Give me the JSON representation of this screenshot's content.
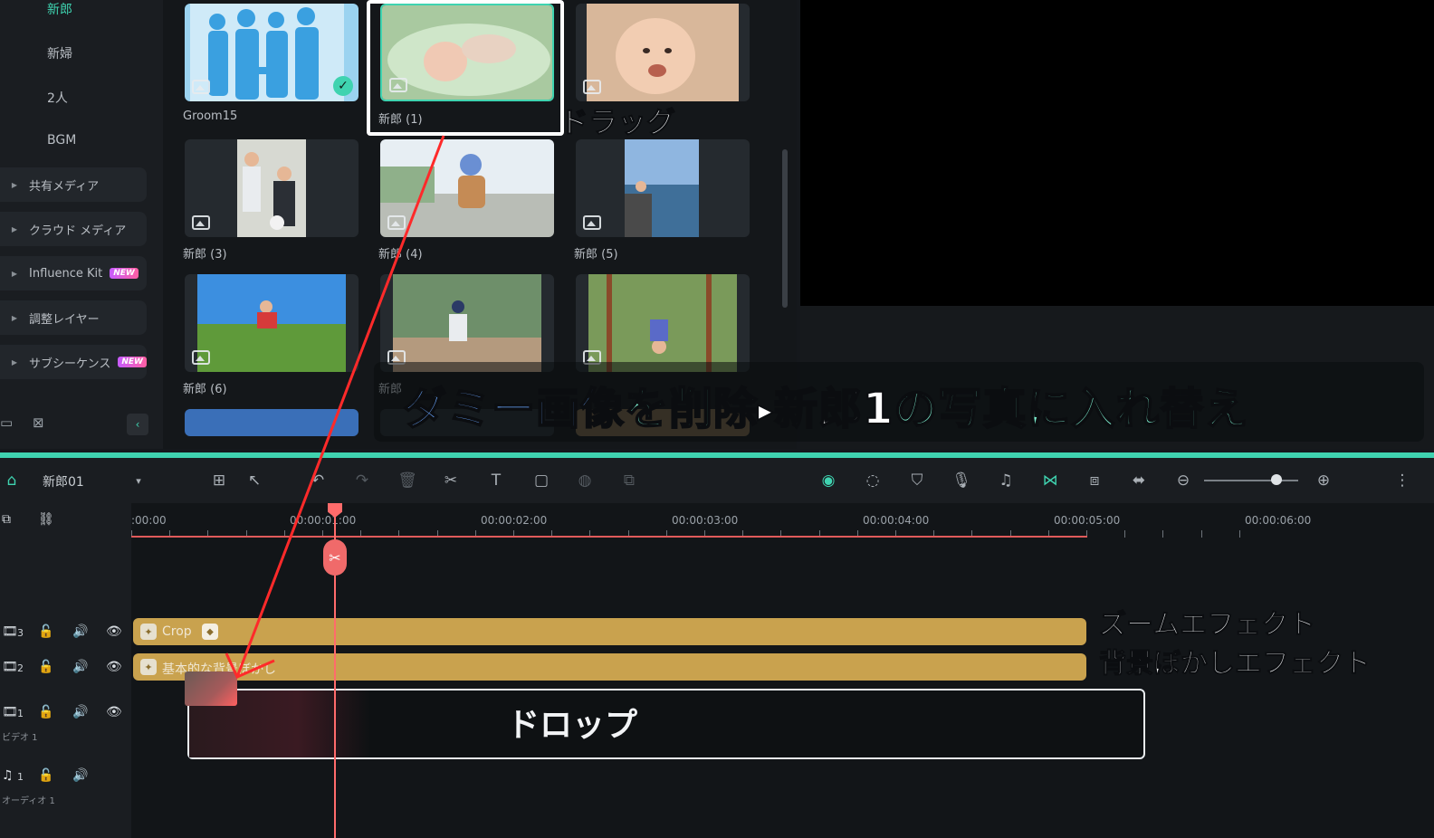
{
  "sidebar": {
    "sub_items": [
      "新郎",
      "新婦",
      "2人",
      "BGM"
    ],
    "groups": [
      {
        "label": "共有メディア",
        "badge": ""
      },
      {
        "label": "クラウド メディア",
        "badge": ""
      },
      {
        "label": "Influence Kit",
        "badge": "NEW"
      },
      {
        "label": "調整レイヤー",
        "badge": ""
      },
      {
        "label": "サブシーケンス",
        "badge": "NEW"
      }
    ],
    "collapse_icon": "‹"
  },
  "media": {
    "tiles": [
      {
        "label": "Groom15",
        "selected_check": true
      },
      {
        "label": "新郎 (1)"
      },
      {
        "label": ""
      },
      {
        "label": "新郎 (3)"
      },
      {
        "label": "新郎 (4)"
      },
      {
        "label": "新郎 (5)"
      },
      {
        "label": "新郎 (6)"
      },
      {
        "label": "新郎"
      },
      {
        "label": ""
      }
    ]
  },
  "annotations": {
    "drag": "ドラッグ",
    "drop": "ドロップ",
    "zoom_effect": "ズームエフェクト",
    "blur_effect": "背景ぼかしエフェクト"
  },
  "banner": {
    "part1": "ダミー画像",
    "part2": "を削除",
    "arrow": "▶",
    "part3": "新郎1",
    "part4": "の写真に入れ替え"
  },
  "toolbar": {
    "sequence_name": "新郎01",
    "dropdown_icon": "▾"
  },
  "ruler": {
    "labels": [
      ":00:00",
      "00:00:01:00",
      "00:00:02:00",
      "00:00:03:00",
      "00:00:04:00",
      "00:00:05:00",
      "00:00:06:00"
    ]
  },
  "tracks": {
    "v3_num": "3",
    "v2_num": "2",
    "v1_num": "1",
    "v1_name": "ビデオ 1",
    "a1_num": "1",
    "a1_name": "オーディオ 1",
    "clip_crop": "Crop",
    "clip_blur": "基本的な背景ぼかし"
  },
  "colors": {
    "accent": "#3fd3b0",
    "playhead": "#ff6b6b",
    "effect_clip": "#c9a24e",
    "arrow": "#ff2a2a"
  }
}
